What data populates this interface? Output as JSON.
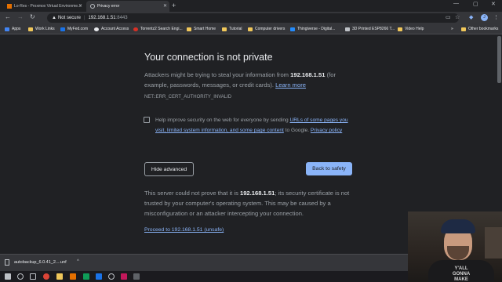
{
  "tabs": [
    {
      "title": "Lo-Res - Proxmox Virtual Environme...",
      "active": false
    },
    {
      "title": "Privacy error",
      "active": true
    }
  ],
  "omnibox": {
    "security_label": "Not secure",
    "host": "192.168.1.51",
    "port": ":8443"
  },
  "profile_initial": "J",
  "bookmarks": [
    {
      "label": "Apps",
      "icon": "apps-grid-icon"
    },
    {
      "label": "Work Links",
      "icon": "folder-icon"
    },
    {
      "label": "MyFed.com",
      "icon": "site-icon"
    },
    {
      "label": "Account Access",
      "icon": "site-icon"
    },
    {
      "label": "Torrentz2 Search Engi...",
      "icon": "site-icon"
    },
    {
      "label": "Smart Home",
      "icon": "folder-icon"
    },
    {
      "label": "Tutorial",
      "icon": "folder-icon"
    },
    {
      "label": "Computer drivers",
      "icon": "folder-icon"
    },
    {
      "label": "Thingiverse - Digital...",
      "icon": "site-icon"
    },
    {
      "label": "3D Printed ESP8266 T...",
      "icon": "site-icon"
    },
    {
      "label": "Video Help",
      "icon": "folder-icon"
    },
    {
      "label": "Other bookmarks",
      "icon": "folder-icon"
    }
  ],
  "interstitial": {
    "title": "Your connection is not private",
    "msg_prefix": "Attackers might be trying to steal your information from ",
    "msg_host": "192.168.1.51",
    "msg_suffix": " (for example, passwords, messages, or credit cards). ",
    "learn_more": "Learn more",
    "error_code": "NET::ERR_CERT_AUTHORITY_INVALID",
    "improve_prefix": "Help improve security on the web for everyone by sending ",
    "improve_link": "URLs of some pages you visit, limited system information, and some page content",
    "improve_suffix": " to Google. ",
    "privacy_policy": "Privacy policy",
    "hide_advanced": "Hide advanced",
    "back_to_safety": "Back to safety",
    "detail_prefix": "This server could not prove that it is ",
    "detail_host": "192.168.1.51",
    "detail_suffix": "; its security certificate is not trusted by your computer's operating system. This may be caused by a misconfiguration or an attacker intercepting your connection.",
    "proceed_link": "Proceed to 192.168.1.51 (unsafe)"
  },
  "download": {
    "filename": "autobackup_6.0.41_2....unf"
  },
  "webcam_shirt_text": "Y'ALL\nGONNA\nMAKE"
}
